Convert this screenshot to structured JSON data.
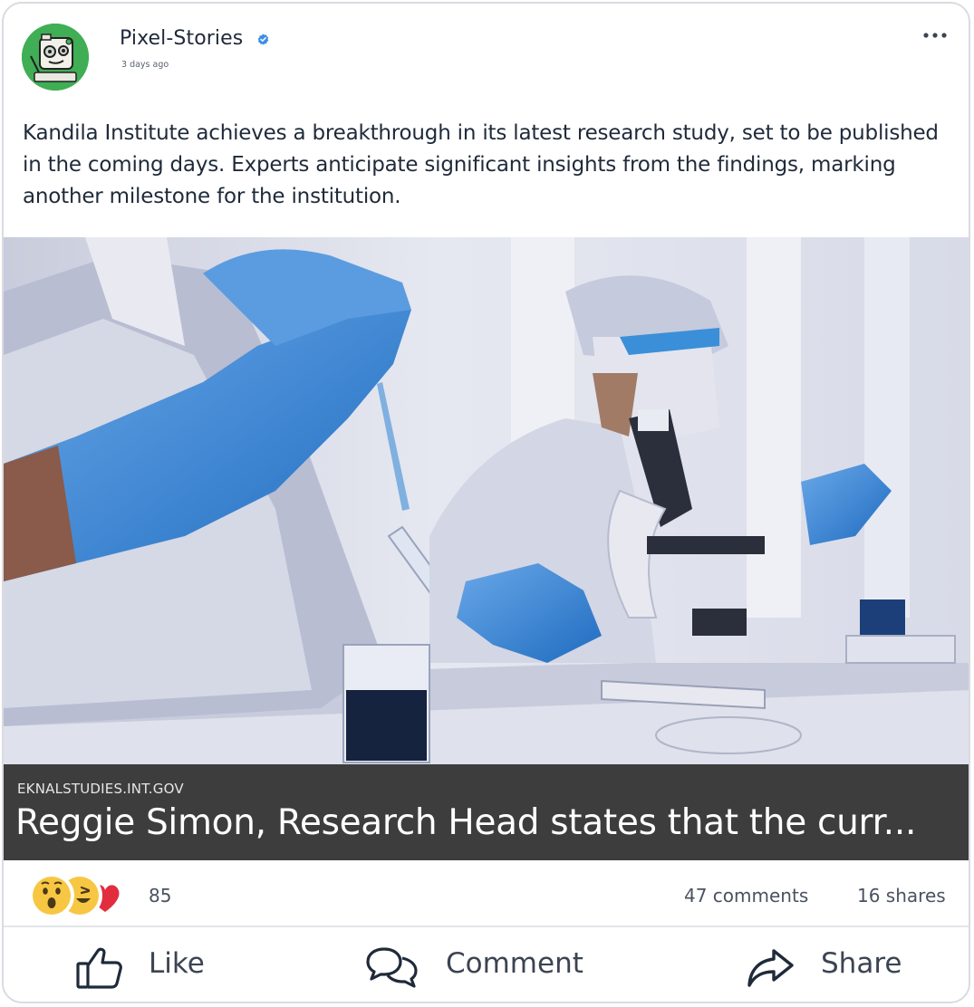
{
  "post": {
    "author": "Pixel-Stories",
    "timestamp": "3 days ago",
    "text": "Kandila Institute achieves a breakthrough in its latest research study, set to be published in the coming days. Experts anticipate significant insights from the findings, marking another milestone for the institution.",
    "verified": true
  },
  "link": {
    "domain": "EKNALSTUDIES.INT.GOV",
    "title": "Reggie Simon, Research Head states that the curr..."
  },
  "stats": {
    "reaction_count": "85",
    "reactions": [
      "wow-icon",
      "haha-icon",
      "love-icon"
    ],
    "comments": "47 comments",
    "shares": "16 shares"
  },
  "actions": {
    "like": "Like",
    "comment": "Comment",
    "share": "Share"
  },
  "colors": {
    "link_bar": "#3d3d3d",
    "verified_badge": "#3b8ee8",
    "love": "#e22d3e",
    "avatar_bg": "#3fae54"
  }
}
